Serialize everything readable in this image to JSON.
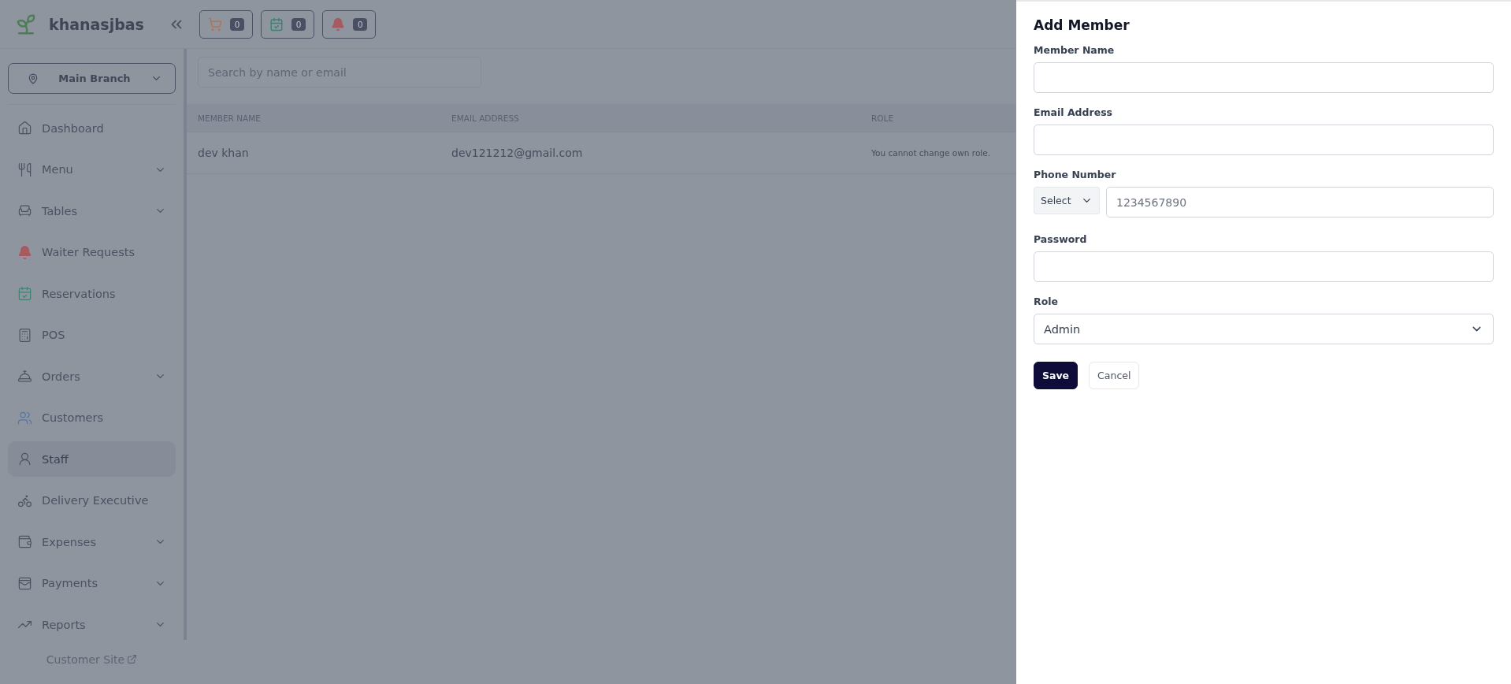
{
  "header": {
    "brand": "khanasjbas",
    "badges": [
      {
        "kind": "cart",
        "count": "0"
      },
      {
        "kind": "calendar",
        "count": "0"
      },
      {
        "kind": "bell",
        "count": "0"
      }
    ]
  },
  "sidebar": {
    "branch": "Main Branch",
    "items": [
      {
        "kind": "home",
        "label": "Dashboard",
        "has_submenu": false,
        "selected": false
      },
      {
        "kind": "menu",
        "label": "Menu",
        "has_submenu": true,
        "selected": false
      },
      {
        "kind": "tables",
        "label": "Tables",
        "has_submenu": true,
        "selected": false
      },
      {
        "kind": "bell",
        "label": "Waiter Requests",
        "has_submenu": false,
        "selected": false
      },
      {
        "kind": "calendar",
        "label": "Reservations",
        "has_submenu": false,
        "selected": false
      },
      {
        "kind": "pos",
        "label": "POS",
        "has_submenu": false,
        "selected": false
      },
      {
        "kind": "orders",
        "label": "Orders",
        "has_submenu": true,
        "selected": false
      },
      {
        "kind": "customers",
        "label": "Customers",
        "has_submenu": false,
        "selected": false
      },
      {
        "kind": "staff",
        "label": "Staff",
        "has_submenu": false,
        "selected": true
      },
      {
        "kind": "delivery",
        "label": "Delivery Executive",
        "has_submenu": false,
        "selected": false
      },
      {
        "kind": "expenses",
        "label": "Expenses",
        "has_submenu": true,
        "selected": false
      },
      {
        "kind": "payments",
        "label": "Payments",
        "has_submenu": true,
        "selected": false
      },
      {
        "kind": "reports",
        "label": "Reports",
        "has_submenu": true,
        "selected": false
      }
    ],
    "footer_link": "Customer Site"
  },
  "search": {
    "placeholder": "Search by name or email"
  },
  "table": {
    "columns": [
      "MEMBER NAME",
      "EMAIL ADDRESS",
      "ROLE"
    ],
    "rows": [
      [
        "dev khan",
        "dev121212@gmail.com",
        "You cannot change own role."
      ]
    ]
  },
  "drawer": {
    "title": "Add Member",
    "fields": [
      {
        "kind": "text",
        "label": "Member Name"
      },
      {
        "kind": "text",
        "label": "Email Address"
      },
      {
        "kind": "phone",
        "label": "Phone Number",
        "code": "Select",
        "placeholder": "1234567890"
      },
      {
        "kind": "password",
        "label": "Password"
      },
      {
        "kind": "select",
        "label": "Role",
        "value": "Admin"
      }
    ],
    "buttons": [
      {
        "kind": "primary",
        "label": "Save"
      },
      {
        "kind": "secondary",
        "label": "Cancel"
      }
    ]
  }
}
